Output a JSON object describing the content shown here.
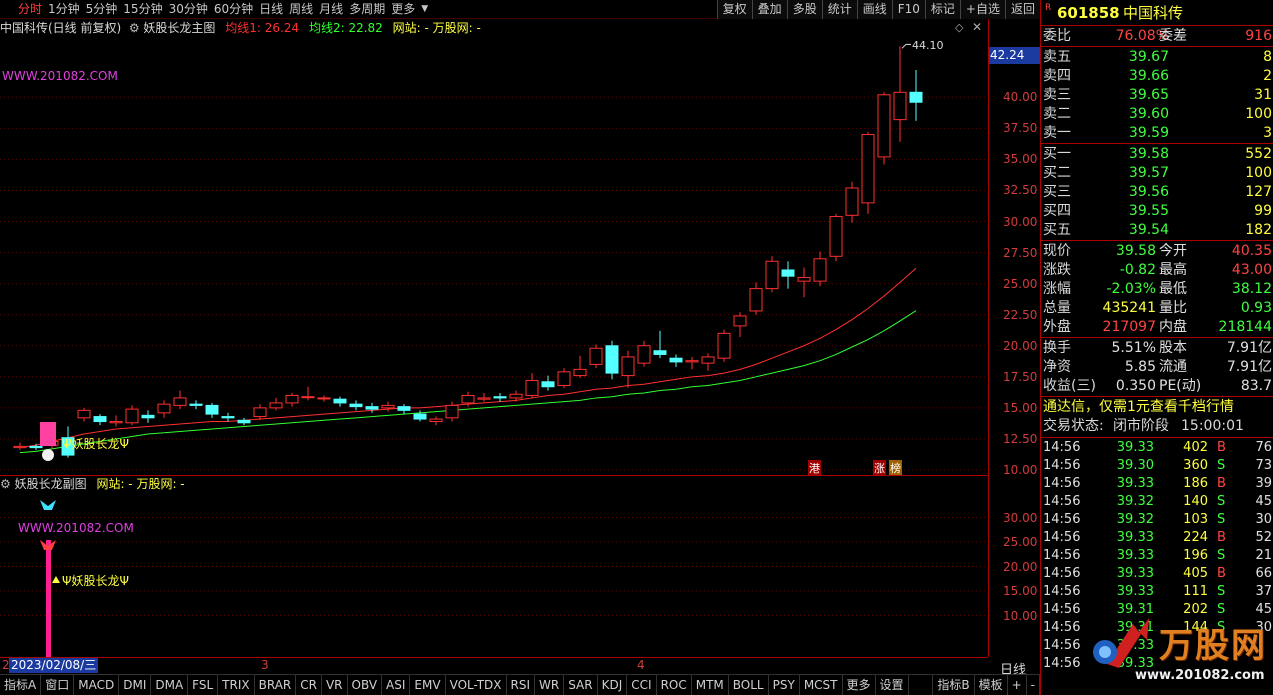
{
  "toolbar": {
    "periods": [
      "分时",
      "1分钟",
      "5分钟",
      "15分钟",
      "30分钟",
      "60分钟",
      "日线",
      "周线",
      "月线",
      "多周期",
      "更多"
    ],
    "active_period": "分时",
    "buttons": [
      "复权",
      "叠加",
      "多股",
      "统计",
      "画线",
      "F10",
      "标记",
      "+自选",
      "返回"
    ]
  },
  "main_chart": {
    "stock_name": "中国科传(日线 前复权)",
    "indicator": "妖股长龙主图",
    "ma1_label": "均线1: 26.24",
    "ma2_label": "均线2: 22.82",
    "site_label": "网站: - 万股网: -",
    "watermark": "WWW.201082.COM",
    "signal_label": "Ψ妖股长龙Ψ",
    "high_label": "44.10",
    "price_box": "42.24",
    "tags": [
      "港",
      "涨",
      "榜"
    ],
    "colors": {
      "ma1": "#ff3030",
      "ma2": "#30ff30",
      "up": "#ff3030",
      "down": "#54ffff"
    }
  },
  "chart_data": [
    {
      "type": "candlestick",
      "y_ticks": [
        "40.00",
        "37.50",
        "35.00",
        "32.50",
        "30.00",
        "27.50",
        "25.00",
        "22.50",
        "20.00",
        "17.50",
        "15.00",
        "12.50",
        "10.00"
      ],
      "ylim": [
        10,
        43
      ],
      "candles": [
        {
          "o": 11.8,
          "c": 11.9,
          "h": 12.2,
          "l": 11.6
        },
        {
          "o": 11.9,
          "c": 11.8,
          "h": 12.1,
          "l": 11.6
        },
        {
          "o": 12.0,
          "c": 12.3,
          "h": 12.6,
          "l": 11.7
        },
        {
          "o": 12.6,
          "c": 11.2,
          "h": 13.5,
          "l": 11.0
        },
        {
          "o": 14.2,
          "c": 14.8,
          "h": 15.0,
          "l": 13.9
        },
        {
          "o": 14.3,
          "c": 13.9,
          "h": 14.5,
          "l": 13.6
        },
        {
          "o": 13.8,
          "c": 13.9,
          "h": 14.4,
          "l": 13.5
        },
        {
          "o": 13.8,
          "c": 14.9,
          "h": 15.2,
          "l": 13.6
        },
        {
          "o": 14.4,
          "c": 14.2,
          "h": 14.8,
          "l": 13.8
        },
        {
          "o": 14.6,
          "c": 15.3,
          "h": 15.6,
          "l": 14.2
        },
        {
          "o": 15.2,
          "c": 15.8,
          "h": 16.4,
          "l": 14.9
        },
        {
          "o": 15.3,
          "c": 15.2,
          "h": 15.6,
          "l": 14.9
        },
        {
          "o": 15.2,
          "c": 14.5,
          "h": 15.4,
          "l": 14.2
        },
        {
          "o": 14.3,
          "c": 14.2,
          "h": 14.6,
          "l": 13.9
        },
        {
          "o": 14.0,
          "c": 13.8,
          "h": 14.2,
          "l": 13.6
        },
        {
          "o": 14.3,
          "c": 15.0,
          "h": 15.3,
          "l": 14.0
        },
        {
          "o": 15.0,
          "c": 15.4,
          "h": 15.8,
          "l": 14.8
        },
        {
          "o": 15.4,
          "c": 16.0,
          "h": 16.2,
          "l": 15.1
        },
        {
          "o": 15.9,
          "c": 15.9,
          "h": 16.7,
          "l": 15.6
        },
        {
          "o": 15.8,
          "c": 15.8,
          "h": 16.0,
          "l": 15.5
        },
        {
          "o": 15.7,
          "c": 15.4,
          "h": 15.9,
          "l": 15.1
        },
        {
          "o": 15.3,
          "c": 15.1,
          "h": 15.6,
          "l": 14.8
        },
        {
          "o": 15.1,
          "c": 14.9,
          "h": 15.4,
          "l": 14.6
        },
        {
          "o": 15.0,
          "c": 15.2,
          "h": 15.5,
          "l": 14.7
        },
        {
          "o": 15.1,
          "c": 14.8,
          "h": 15.3,
          "l": 14.5
        },
        {
          "o": 14.5,
          "c": 14.1,
          "h": 14.8,
          "l": 13.9
        },
        {
          "o": 13.9,
          "c": 14.1,
          "h": 14.3,
          "l": 13.6
        },
        {
          "o": 14.2,
          "c": 15.2,
          "h": 15.5,
          "l": 13.9
        },
        {
          "o": 15.4,
          "c": 16.0,
          "h": 16.3,
          "l": 15.1
        },
        {
          "o": 15.7,
          "c": 15.8,
          "h": 16.2,
          "l": 15.5
        },
        {
          "o": 15.9,
          "c": 15.8,
          "h": 16.2,
          "l": 15.5
        },
        {
          "o": 15.8,
          "c": 16.1,
          "h": 16.4,
          "l": 15.5
        },
        {
          "o": 16.0,
          "c": 17.2,
          "h": 17.8,
          "l": 15.8
        },
        {
          "o": 17.1,
          "c": 16.7,
          "h": 17.6,
          "l": 16.4
        },
        {
          "o": 16.8,
          "c": 17.9,
          "h": 18.2,
          "l": 16.6
        },
        {
          "o": 17.6,
          "c": 18.1,
          "h": 19.2,
          "l": 17.4
        },
        {
          "o": 18.5,
          "c": 19.8,
          "h": 20.1,
          "l": 18.2
        },
        {
          "o": 20.0,
          "c": 17.8,
          "h": 20.4,
          "l": 17.3
        },
        {
          "o": 17.6,
          "c": 19.1,
          "h": 19.6,
          "l": 16.6
        },
        {
          "o": 18.6,
          "c": 20.0,
          "h": 20.4,
          "l": 18.3
        },
        {
          "o": 19.6,
          "c": 19.3,
          "h": 21.2,
          "l": 19.0
        },
        {
          "o": 19.0,
          "c": 18.7,
          "h": 19.3,
          "l": 18.3
        },
        {
          "o": 18.7,
          "c": 18.8,
          "h": 19.1,
          "l": 18.1
        },
        {
          "o": 18.6,
          "c": 19.1,
          "h": 19.4,
          "l": 18.0
        },
        {
          "o": 19.0,
          "c": 21.0,
          "h": 21.3,
          "l": 18.7
        },
        {
          "o": 21.6,
          "c": 22.4,
          "h": 22.7,
          "l": 20.7
        },
        {
          "o": 22.8,
          "c": 24.6,
          "h": 25.1,
          "l": 22.5
        },
        {
          "o": 24.6,
          "c": 26.8,
          "h": 27.2,
          "l": 24.3
        },
        {
          "o": 26.1,
          "c": 25.6,
          "h": 26.8,
          "l": 24.6
        },
        {
          "o": 25.2,
          "c": 25.5,
          "h": 26.3,
          "l": 23.9
        },
        {
          "o": 25.2,
          "c": 27.0,
          "h": 27.6,
          "l": 24.8
        },
        {
          "o": 27.2,
          "c": 30.4,
          "h": 30.6,
          "l": 26.8
        },
        {
          "o": 30.5,
          "c": 32.7,
          "h": 33.2,
          "l": 29.9
        },
        {
          "o": 31.5,
          "c": 37.0,
          "h": 37.2,
          "l": 30.6
        },
        {
          "o": 35.2,
          "c": 40.2,
          "h": 40.4,
          "l": 34.6
        },
        {
          "o": 38.2,
          "c": 40.4,
          "h": 44.1,
          "l": 36.4
        },
        {
          "o": 40.4,
          "c": 39.6,
          "h": 42.2,
          "l": 38.1
        }
      ],
      "ma1": [
        11.8,
        12.0,
        12.3,
        12.6,
        12.9,
        13.1,
        13.3,
        13.4,
        13.5,
        13.6,
        13.7,
        13.8,
        13.9,
        13.9,
        14.0,
        14.1,
        14.2,
        14.3,
        14.4,
        14.5,
        14.6,
        14.7,
        14.8,
        14.9,
        15.0,
        15.0,
        15.1,
        15.2,
        15.3,
        15.4,
        15.5,
        15.6,
        15.8,
        16.0,
        16.1,
        16.3,
        16.5,
        16.6,
        16.8,
        16.9,
        17.1,
        17.3,
        17.5,
        17.6,
        17.8,
        18.1,
        18.5,
        19.0,
        19.5,
        20.0,
        20.6,
        21.3,
        22.1,
        23.0,
        24.0,
        25.1,
        26.24
      ],
      "ma2": [
        11.4,
        11.5,
        11.7,
        11.9,
        12.1,
        12.3,
        12.5,
        12.7,
        12.9,
        13.0,
        13.1,
        13.2,
        13.3,
        13.4,
        13.5,
        13.6,
        13.7,
        13.8,
        13.9,
        14.0,
        14.1,
        14.2,
        14.3,
        14.4,
        14.5,
        14.6,
        14.7,
        14.8,
        14.9,
        15.0,
        15.1,
        15.2,
        15.3,
        15.4,
        15.5,
        15.6,
        15.8,
        15.9,
        16.1,
        16.2,
        16.4,
        16.5,
        16.7,
        16.8,
        17.0,
        17.2,
        17.5,
        17.8,
        18.1,
        18.4,
        18.8,
        19.3,
        19.9,
        20.5,
        21.2,
        22.0,
        22.82
      ]
    },
    {
      "type": "bar",
      "y_ticks": [
        "30.00",
        "25.00",
        "20.00",
        "15.00",
        "10.00"
      ],
      "ylim": [
        5,
        35
      ]
    }
  ],
  "sub_chart": {
    "title": "妖股长龙副图",
    "site_label": "网站: - 万股网: -",
    "watermark": "WWW.201082.COM",
    "signal_label": "Ψ妖股长龙Ψ"
  },
  "date_axis": {
    "date_label": "2023/02/08/三",
    "start": "2",
    "month3": "3",
    "month4": "4",
    "period": "日线"
  },
  "indicators": [
    "指标A",
    "窗口",
    "MACD",
    "DMI",
    "DMA",
    "FSL",
    "TRIX",
    "BRAR",
    "CR",
    "VR",
    "OBV",
    "ASI",
    "EMV",
    "VOL-TDX",
    "RSI",
    "WR",
    "SAR",
    "KDJ",
    "CCI",
    "ROC",
    "MTM",
    "BOLL",
    "PSY",
    "MCST",
    "更多",
    "设置"
  ],
  "indicators_right": [
    "指标B",
    "模板"
  ],
  "panel": {
    "badge": "R",
    "code": "601858",
    "name": "中国科传",
    "wb_label": "委比",
    "wb_value": "76.08%",
    "wc_label": "委差",
    "wc_value": "916",
    "asks": [
      {
        "label": "卖五",
        "price": "39.67",
        "vol": "8"
      },
      {
        "label": "卖四",
        "price": "39.66",
        "vol": "2"
      },
      {
        "label": "卖三",
        "price": "39.65",
        "vol": "31"
      },
      {
        "label": "卖二",
        "price": "39.60",
        "vol": "100"
      },
      {
        "label": "卖一",
        "price": "39.59",
        "vol": "3"
      }
    ],
    "bids": [
      {
        "label": "买一",
        "price": "39.58",
        "vol": "552"
      },
      {
        "label": "买二",
        "price": "39.57",
        "vol": "100"
      },
      {
        "label": "买三",
        "price": "39.56",
        "vol": "127"
      },
      {
        "label": "买四",
        "price": "39.55",
        "vol": "99"
      },
      {
        "label": "买五",
        "price": "39.54",
        "vol": "182"
      }
    ],
    "quote": [
      {
        "l1": "现价",
        "v1": "39.58",
        "c1": "green",
        "l2": "今开",
        "v2": "40.35",
        "c2": "red"
      },
      {
        "l1": "涨跌",
        "v1": "-0.82",
        "c1": "green",
        "l2": "最高",
        "v2": "43.00",
        "c2": "red"
      },
      {
        "l1": "涨幅",
        "v1": "-2.03%",
        "c1": "green",
        "l2": "最低",
        "v2": "38.12",
        "c2": "green"
      },
      {
        "l1": "总量",
        "v1": "435241",
        "c1": "yel",
        "l2": "量比",
        "v2": "0.93",
        "c2": "green"
      },
      {
        "l1": "外盘",
        "v1": "217097",
        "c1": "red",
        "l2": "内盘",
        "v2": "218144",
        "c2": "green"
      }
    ],
    "fund": [
      {
        "l1": "换手",
        "v1": "5.51%",
        "l2": "股本",
        "v2": "7.91亿"
      },
      {
        "l1": "净资",
        "v1": "5.85",
        "l2": "流通",
        "v2": "7.91亿"
      },
      {
        "l1": "收益(三)",
        "v1": "0.350",
        "l2": "PE(动)",
        "v2": "83.7"
      }
    ],
    "ad": "通达信，仅需1元查看千档行情",
    "status_label": "交易状态:",
    "status_value": "闭市阶段",
    "status_time": "15:00:01",
    "ticks": [
      {
        "t": "14:56",
        "p": "39.33",
        "v": "402",
        "d": "B",
        "n": "76"
      },
      {
        "t": "14:56",
        "p": "39.30",
        "v": "360",
        "d": "S",
        "n": "73"
      },
      {
        "t": "14:56",
        "p": "39.33",
        "v": "186",
        "d": "B",
        "n": "39"
      },
      {
        "t": "14:56",
        "p": "39.32",
        "v": "140",
        "d": "S",
        "n": "45"
      },
      {
        "t": "14:56",
        "p": "39.32",
        "v": "103",
        "d": "S",
        "n": "30"
      },
      {
        "t": "14:56",
        "p": "39.33",
        "v": "224",
        "d": "B",
        "n": "52"
      },
      {
        "t": "14:56",
        "p": "39.33",
        "v": "196",
        "d": "S",
        "n": "21"
      },
      {
        "t": "14:56",
        "p": "39.33",
        "v": "405",
        "d": "B",
        "n": "66"
      },
      {
        "t": "14:56",
        "p": "39.33",
        "v": "111",
        "d": "S",
        "n": "37"
      },
      {
        "t": "14:56",
        "p": "39.31",
        "v": "202",
        "d": "S",
        "n": "45"
      },
      {
        "t": "14:56",
        "p": "39.31",
        "v": "144",
        "d": "S",
        "n": "30"
      },
      {
        "t": "14:56",
        "p": "39.33",
        "v": "",
        "d": "",
        "n": ""
      },
      {
        "t": "14:56",
        "p": "39.33",
        "v": "",
        "d": "",
        "n": ""
      }
    ],
    "logo_text": "万股网",
    "logo_url": "www.201082.com"
  }
}
